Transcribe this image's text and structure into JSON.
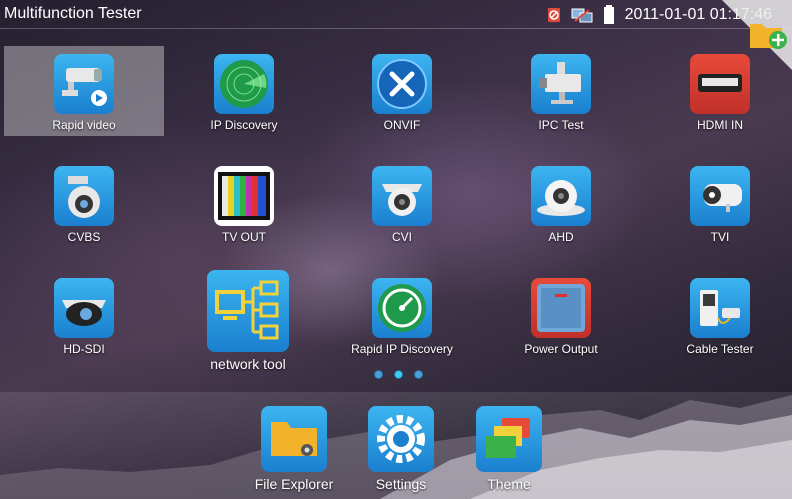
{
  "status_bar": {
    "title": "Multifunction Tester",
    "clock": "2011-01-01 01:17:46",
    "icons": [
      "sd-card-icon",
      "network-icon",
      "battery-icon"
    ]
  },
  "corner": {
    "icon": "add-folder-icon"
  },
  "apps": [
    {
      "label": "Rapid video",
      "icon": "cctv-camera-play-icon"
    },
    {
      "label": "IP Discovery",
      "icon": "radar-icon"
    },
    {
      "label": "ONVIF",
      "icon": "tools-icon"
    },
    {
      "label": "IPC Test",
      "icon": "ip-camera-icon"
    },
    {
      "label": "HDMI IN",
      "icon": "hdmi-port-icon"
    },
    {
      "label": "CVBS",
      "icon": "dome-camera-icon"
    },
    {
      "label": "TV OUT",
      "icon": "color-bars-icon"
    },
    {
      "label": "CVI",
      "icon": "dome-camera-icon"
    },
    {
      "label": "AHD",
      "icon": "dome-camera-icon"
    },
    {
      "label": "TVI",
      "icon": "bullet-camera-icon"
    },
    {
      "label": "HD-SDI",
      "icon": "speed-dome-icon"
    },
    {
      "label": "network tool",
      "icon": "network-diagram-icon"
    },
    {
      "label": "Rapid IP Discovery",
      "icon": "speedometer-icon"
    },
    {
      "label": "Power Output",
      "icon": "power-switch-icon"
    },
    {
      "label": "Cable Tester",
      "icon": "cable-tester-icon"
    }
  ],
  "pager": {
    "pages": 3,
    "active": 1
  },
  "dock": [
    {
      "label": "File Explorer",
      "icon": "folder-icon"
    },
    {
      "label": "Settings",
      "icon": "gear-icon"
    },
    {
      "label": "Theme",
      "icon": "theme-cards-icon"
    }
  ],
  "colors": {
    "accent": "#1a7fcf",
    "highlight": "#d2d2d2"
  }
}
